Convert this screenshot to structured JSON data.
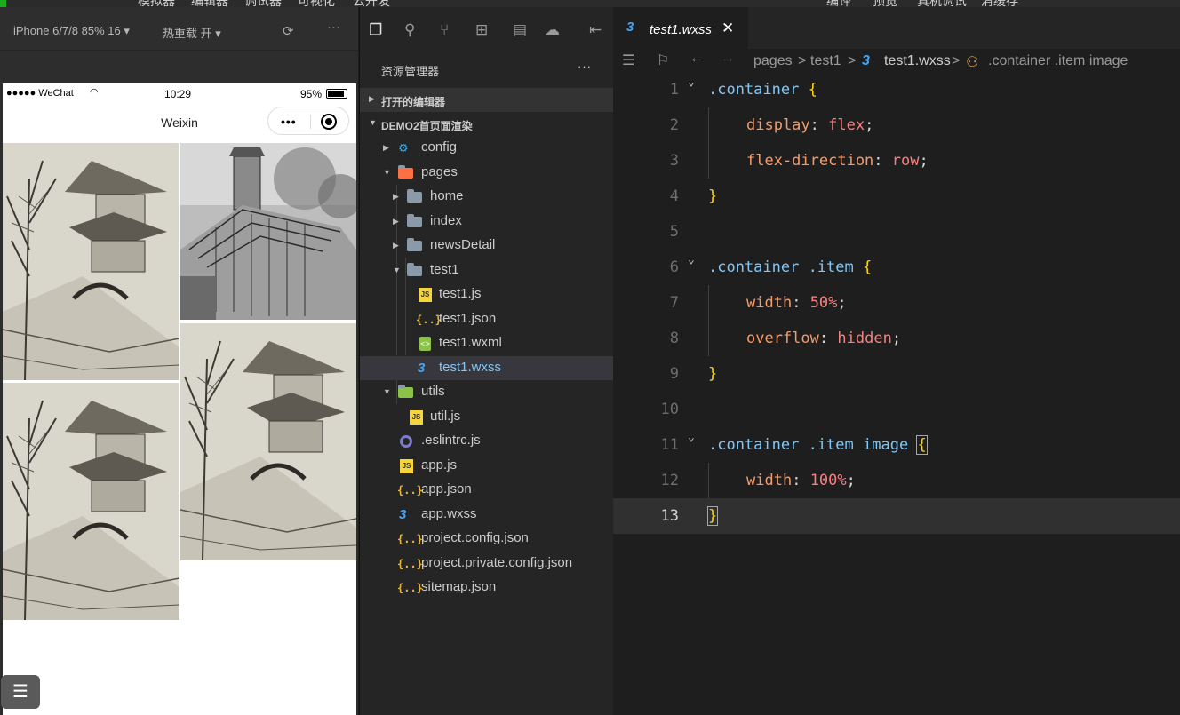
{
  "top_menu": [
    "模拟器",
    "编辑器",
    "调试器",
    "可视化",
    "云开发",
    "编译",
    "预览",
    "真机调试",
    "清缓存"
  ],
  "simulator": {
    "device": "iPhone 6/7/8 85% 16 ▾",
    "hot_reload": "热重载 开 ▾",
    "status_carrier": "●●●●● WeChat",
    "status_time": "10:29",
    "status_battery": "95%",
    "nav_title": "Weixin",
    "capsule_dots": "•••"
  },
  "explorer": {
    "title": "资源管理器",
    "more": "···",
    "section_open": "打开的编辑器",
    "section_project": "DEMO2首页面渲染",
    "tree": [
      {
        "label": "config",
        "icon": "config-folder-icon"
      },
      {
        "label": "pages",
        "icon": "pages-folder-icon"
      },
      {
        "label": "home",
        "icon": "folder-icon"
      },
      {
        "label": "index",
        "icon": "folder-icon"
      },
      {
        "label": "newsDetail",
        "icon": "folder-icon"
      },
      {
        "label": "test1",
        "icon": "folder-open-icon"
      },
      {
        "label": "test1.js",
        "icon": "js-file-icon"
      },
      {
        "label": "test1.json",
        "icon": "json-file-icon"
      },
      {
        "label": "test1.wxml",
        "icon": "wxml-file-icon"
      },
      {
        "label": "test1.wxss",
        "icon": "css-file-icon"
      },
      {
        "label": "utils",
        "icon": "utils-folder-icon"
      },
      {
        "label": "util.js",
        "icon": "js-file-icon"
      },
      {
        "label": ".eslintrc.js",
        "icon": "eslint-icon"
      },
      {
        "label": "app.js",
        "icon": "js-file-icon"
      },
      {
        "label": "app.json",
        "icon": "json-file-icon"
      },
      {
        "label": "app.wxss",
        "icon": "css-file-icon"
      },
      {
        "label": "project.config.json",
        "icon": "json-file-icon"
      },
      {
        "label": "project.private.config.json",
        "icon": "json-file-icon"
      },
      {
        "label": "sitemap.json",
        "icon": "json-file-icon"
      }
    ]
  },
  "editor": {
    "tab_label": "test1.wxss",
    "breadcrumb": [
      "pages",
      ">",
      "test1",
      ">",
      "test1.wxss",
      ">",
      ".container .item image"
    ],
    "line_numbers": [
      "1",
      "2",
      "3",
      "4",
      "5",
      "6",
      "7",
      "8",
      "9",
      "10",
      "11",
      "12",
      "13"
    ],
    "code": {
      "l1_sel": ".container",
      "l1_brace": "{",
      "l2_prop": "display",
      "l2_val": "flex",
      "l3_prop": "flex-direction",
      "l3_val": "row",
      "l4_brace": "}",
      "l6_sel": ".container .item",
      "l6_brace": "{",
      "l7_prop": "width",
      "l7_val": "50%",
      "l8_prop": "overflow",
      "l8_val": "hidden",
      "l9_brace": "}",
      "l11_sel": ".container .item ",
      "l11_tag": "image",
      "l11_brace": "{",
      "l12_prop": "width",
      "l12_val": "100%",
      "l13_brace": "}",
      "colon": ":",
      "semicolon": ";"
    }
  }
}
